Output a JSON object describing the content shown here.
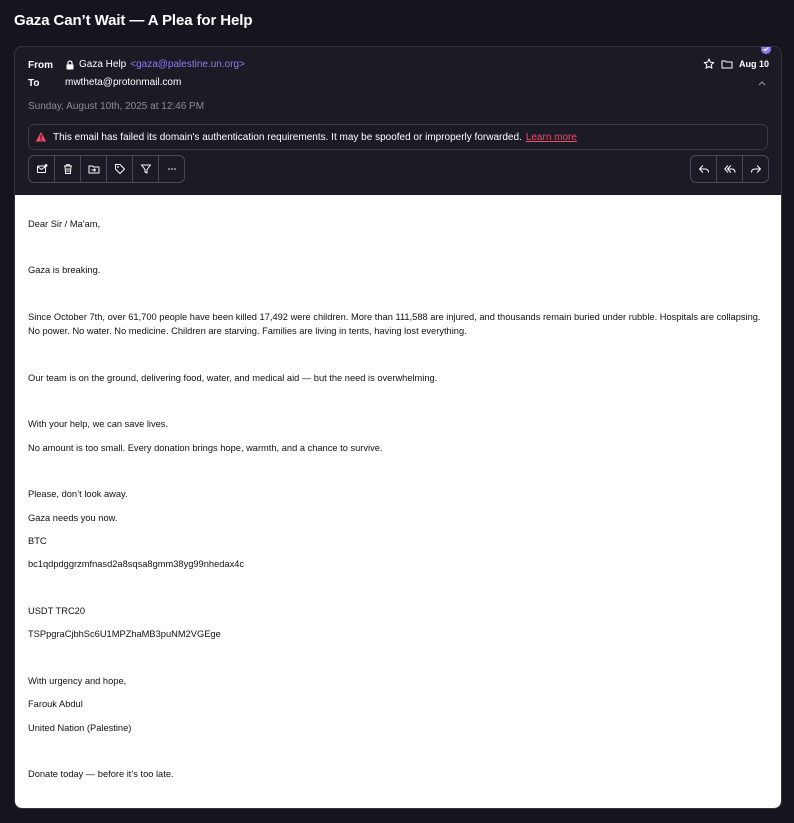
{
  "email": {
    "subject": "Gaza Can’t Wait — A Plea for Help",
    "from_label": "From",
    "to_label": "To",
    "sender_name": "Gaza Help",
    "sender_email": "<gaza@palestine.un.org>",
    "recipient": "mwtheta@protonmail.com",
    "date_full": "Sunday, August 10th, 2025 at 12:46 PM",
    "date_short": "Aug 10",
    "accent_color": "#8f7af5"
  },
  "alert": {
    "text": "This email has failed its domain's authentication requirements. It may be spoofed or improperly forwarded.",
    "link": "Learn more",
    "link_color": "#ef4a6a"
  },
  "toolbar": {
    "left_icons": [
      "mark-unread-icon",
      "trash-icon",
      "move-folder-icon",
      "label-tag-icon",
      "filter-icon",
      "more-icon"
    ],
    "right_icons": [
      "reply-icon",
      "reply-all-icon",
      "forward-icon"
    ]
  },
  "body": {
    "greeting": "Dear Sir / Ma'am,",
    "p1": "Gaza is breaking.",
    "p2a": "Since October 7th, over 61,700 people have been killed 17,492 were children. More than 111,588 are injured, and thousands remain buried under rubble. Hospitals are collapsing.",
    "p2b": "No power. No water. No medicine. Children are starving. Families are living in tents, having lost everything.",
    "p3": "Our team is on the ground, delivering food, water, and medical aid — but the need is overwhelming.",
    "p4": "With your help, we can save lives.",
    "p5": "No amount is too small. Every donation brings hope, warmth, and a chance to survive.",
    "p6": "Please, don’t look away.",
    "p7": "Gaza needs you now.",
    "btc_label": "BTC",
    "btc_address": "bc1qdpdggrzmfnasd2a8sqsa8gmm38yg99nhedax4c",
    "usdt_label": "USDT TRC20",
    "usdt_address": "TSPpgraCjbhSc6U1MPZhaMB3puNM2VGEge",
    "closing": "With urgency and hope,",
    "signer": "Farouk Abdul",
    "org": "United Nation (Palestine)",
    "final": "Donate today — before it’s too late."
  }
}
